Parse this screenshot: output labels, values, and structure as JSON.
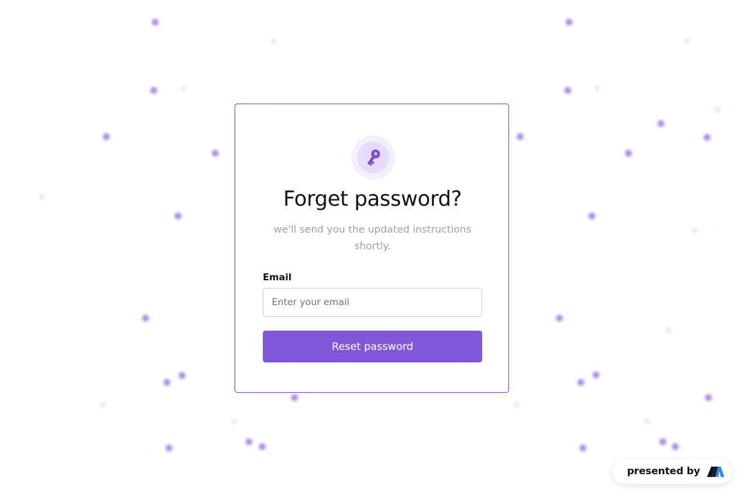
{
  "card": {
    "title": "Forget password?",
    "subtitle": "we'll send you the updated instructions shortly.",
    "icon": "key-icon"
  },
  "form": {
    "email_label": "Email",
    "email_placeholder": "Enter your email",
    "email_value": "",
    "submit_label": "Reset password"
  },
  "badge": {
    "text": "presented by",
    "logo_icon": "brand-logo-icon"
  },
  "colors": {
    "accent": "#8057d9",
    "card_border": "#7b4fd6",
    "subtitle": "#9aa0ad",
    "dots": "#8b5fe0"
  }
}
